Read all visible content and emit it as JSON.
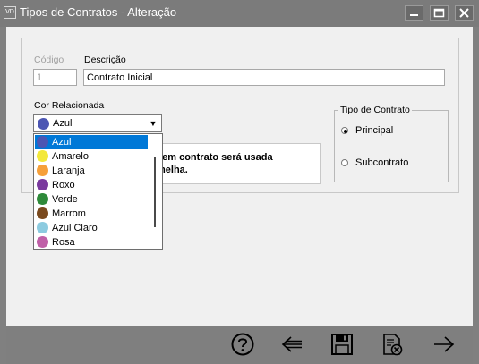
{
  "window": {
    "title": "Tipos de Contratos - Alteração",
    "app_icon_text": "VD"
  },
  "form": {
    "codigo": {
      "label": "Código",
      "value": "1"
    },
    "descricao": {
      "label": "Descrição",
      "value": "Contrato Inicial"
    },
    "cor": {
      "label": "Cor Relacionada",
      "selected": "Azul",
      "selected_color": "#4c56b3"
    },
    "tipo": {
      "label": "Tipo de Contrato",
      "options": [
        "Principal",
        "Subcontrato"
      ],
      "selected": "Principal"
    },
    "note": {
      "line1": "sem contrato será usada",
      "line2": "melha."
    }
  },
  "dropdown": {
    "items": [
      {
        "label": "Azul",
        "color": "#4c56b3",
        "selected": true
      },
      {
        "label": "Amarelo",
        "color": "#f3e83a",
        "selected": false
      },
      {
        "label": "Laranja",
        "color": "#f6a03a",
        "selected": false
      },
      {
        "label": "Roxo",
        "color": "#7a3a9e",
        "selected": false
      },
      {
        "label": "Verde",
        "color": "#2e8a3a",
        "selected": false
      },
      {
        "label": "Marrom",
        "color": "#7a4a1e",
        "selected": false
      },
      {
        "label": "Azul Claro",
        "color": "#8ccbe0",
        "selected": false
      },
      {
        "label": "Rosa",
        "color": "#c060a8",
        "selected": false
      }
    ]
  },
  "toolbar": {
    "buttons": [
      "help-icon",
      "back-arrow-icon",
      "save-icon",
      "cancel-document-icon",
      "forward-arrow-icon"
    ]
  }
}
